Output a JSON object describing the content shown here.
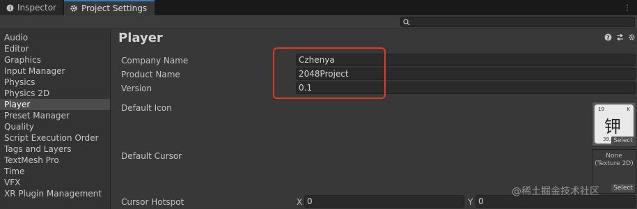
{
  "tabs": {
    "inspector": {
      "label": "Inspector",
      "icon": "info-icon"
    },
    "project_settings": {
      "label": "Project Settings",
      "icon": "gear-icon"
    },
    "more_icon": "kebab-menu-icon"
  },
  "search": {
    "placeholder": "",
    "icon": "search-icon"
  },
  "sidebar": {
    "items": [
      {
        "label": "Audio"
      },
      {
        "label": "Editor"
      },
      {
        "label": "Graphics"
      },
      {
        "label": "Input Manager"
      },
      {
        "label": "Physics"
      },
      {
        "label": "Physics 2D"
      },
      {
        "label": "Player",
        "selected": true
      },
      {
        "label": "Preset Manager"
      },
      {
        "label": "Quality"
      },
      {
        "label": "Script Execution Order"
      },
      {
        "label": "Tags and Layers"
      },
      {
        "label": "TextMesh Pro"
      },
      {
        "label": "Time"
      },
      {
        "label": "VFX"
      },
      {
        "label": "XR Plugin Management"
      }
    ]
  },
  "main": {
    "title": "Player",
    "header_icons": [
      "help-icon",
      "presets-icon",
      "settings-icon"
    ],
    "fields": {
      "company_name": {
        "label": "Company Name",
        "value": "Czhenya"
      },
      "product_name": {
        "label": "Product Name",
        "value": "2048Project"
      },
      "version": {
        "label": "Version",
        "value": "0.1"
      }
    },
    "default_icon": {
      "label": "Default Icon",
      "image_text": {
        "center": "钾",
        "top_left": "19",
        "top_right": "K",
        "bottom": "39.10"
      },
      "select_label": "Select"
    },
    "default_cursor": {
      "label": "Default Cursor",
      "none_line1": "None",
      "none_line2": "(Texture 2D)",
      "select_label": "Select"
    },
    "cursor_hotspot": {
      "label": "Cursor Hotspot",
      "x_label": "X",
      "x_value": "0",
      "y_label": "Y",
      "y_value": "0"
    }
  },
  "watermark": "@稀土掘金技术社区",
  "colors": {
    "background": "#383838",
    "sidebar": "#333333",
    "selected": "#4b4b4b",
    "highlight": "#d64026",
    "tab_accent": "#3a79bb"
  }
}
